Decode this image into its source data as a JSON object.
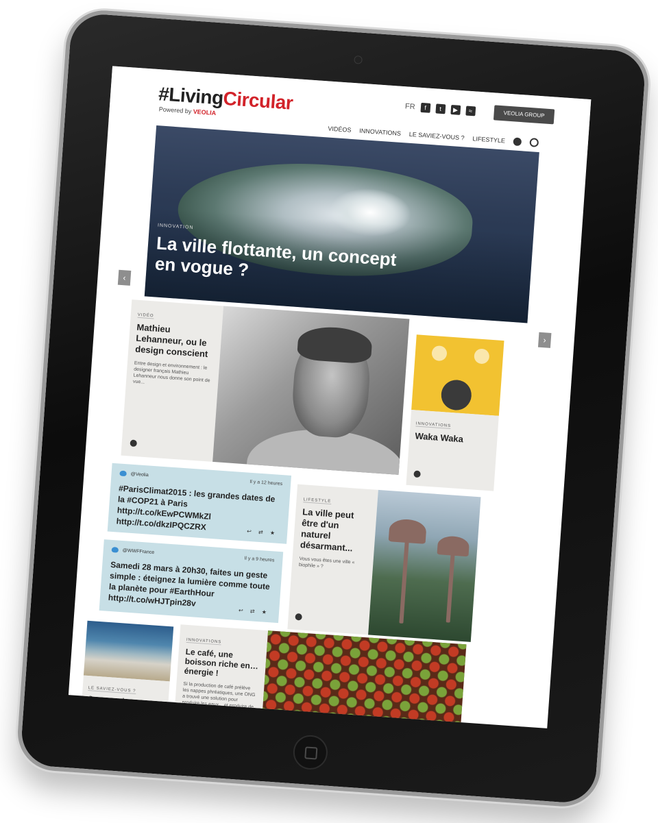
{
  "site": {
    "logo_part1": "#Living",
    "logo_part2": "Circular",
    "powered_by": "Powered by",
    "powered_brand": "VEOLIA",
    "social_label": "FR",
    "group_button": "VEOLIA GROUP"
  },
  "nav": {
    "items": [
      "VIDÉOS",
      "INNOVATIONS",
      "LE SAVIEZ-VOUS ?",
      "LIFESTYLE"
    ]
  },
  "hero": {
    "tag": "INNOVATION",
    "title": "La ville flottante, un concept en vogue ?"
  },
  "cards": {
    "feature": {
      "tag": "VIDÉO",
      "title": "Mathieu Lehanneur, ou le design conscient",
      "excerpt": "Entre design et environnement : le designer français Mathieu Lehanneur nous donne son point de vue..."
    },
    "waka": {
      "tag": "INNOVATIONS",
      "title": "Waka Waka"
    },
    "city": {
      "tag": "LIFESTYLE",
      "title": "La ville peut être d'un naturel désarmant...",
      "excerpt": "Vous vous êtes une ville « biophile » ?"
    },
    "wetlands": {
      "tag": "LE SAVIEZ-VOUS ?",
      "title": "Que sont les zones humides et pourquoi les protéger ?"
    },
    "coffee": {
      "tag": "INNOVATIONS",
      "title": "Le café, une boisson riche en… énergie !",
      "excerpt": "Si la production de café prélève les nappes phréatiques, une ONG a trouvé une solution pour produire les eaux... et produire de l'énergie !"
    }
  },
  "tweets": [
    {
      "handle": "@Veolia",
      "time": "Il y a 12 heures",
      "text": "#ParisClimat2015 : les grandes dates de la #COP21 à Paris http://t.co/kEwPCWMkZl http://t.co/dkzIPQCZRX"
    },
    {
      "handle": "@WWFFrance",
      "time": "Il y a 9 heures",
      "text": "Samedi 28 mars à 20h30, faites un geste simple : éteignez la lumière comme toute la planète pour #EarthHour http://t.co/wHJTpin28v"
    }
  ]
}
